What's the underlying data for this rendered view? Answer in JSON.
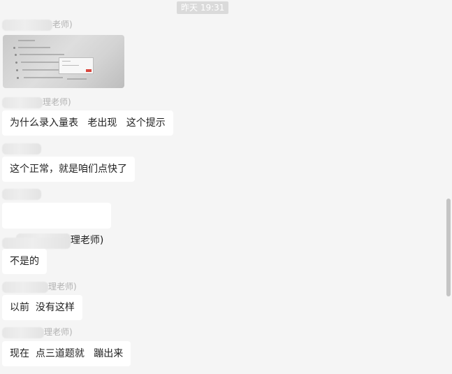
{
  "chat": {
    "timestamp": "昨天 19:31",
    "messages": [
      {
        "sender_suffix": "老师)",
        "type": "image"
      },
      {
        "sender_suffix": "理老师)",
        "text": "为什么录入量表   老出现   这个提示"
      },
      {
        "sender_suffix": "",
        "text": "这个正常，就是咱们点快了"
      },
      {
        "sender_suffix": "",
        "text_suffix": "理老师)"
      },
      {
        "sender_suffix": "",
        "text": "不是的"
      },
      {
        "sender_suffix": "理老师)",
        "text": "以前  没有这样"
      },
      {
        "sender_suffix": "理老师)",
        "text": "现在  点三道题就   蹦出来"
      }
    ]
  }
}
